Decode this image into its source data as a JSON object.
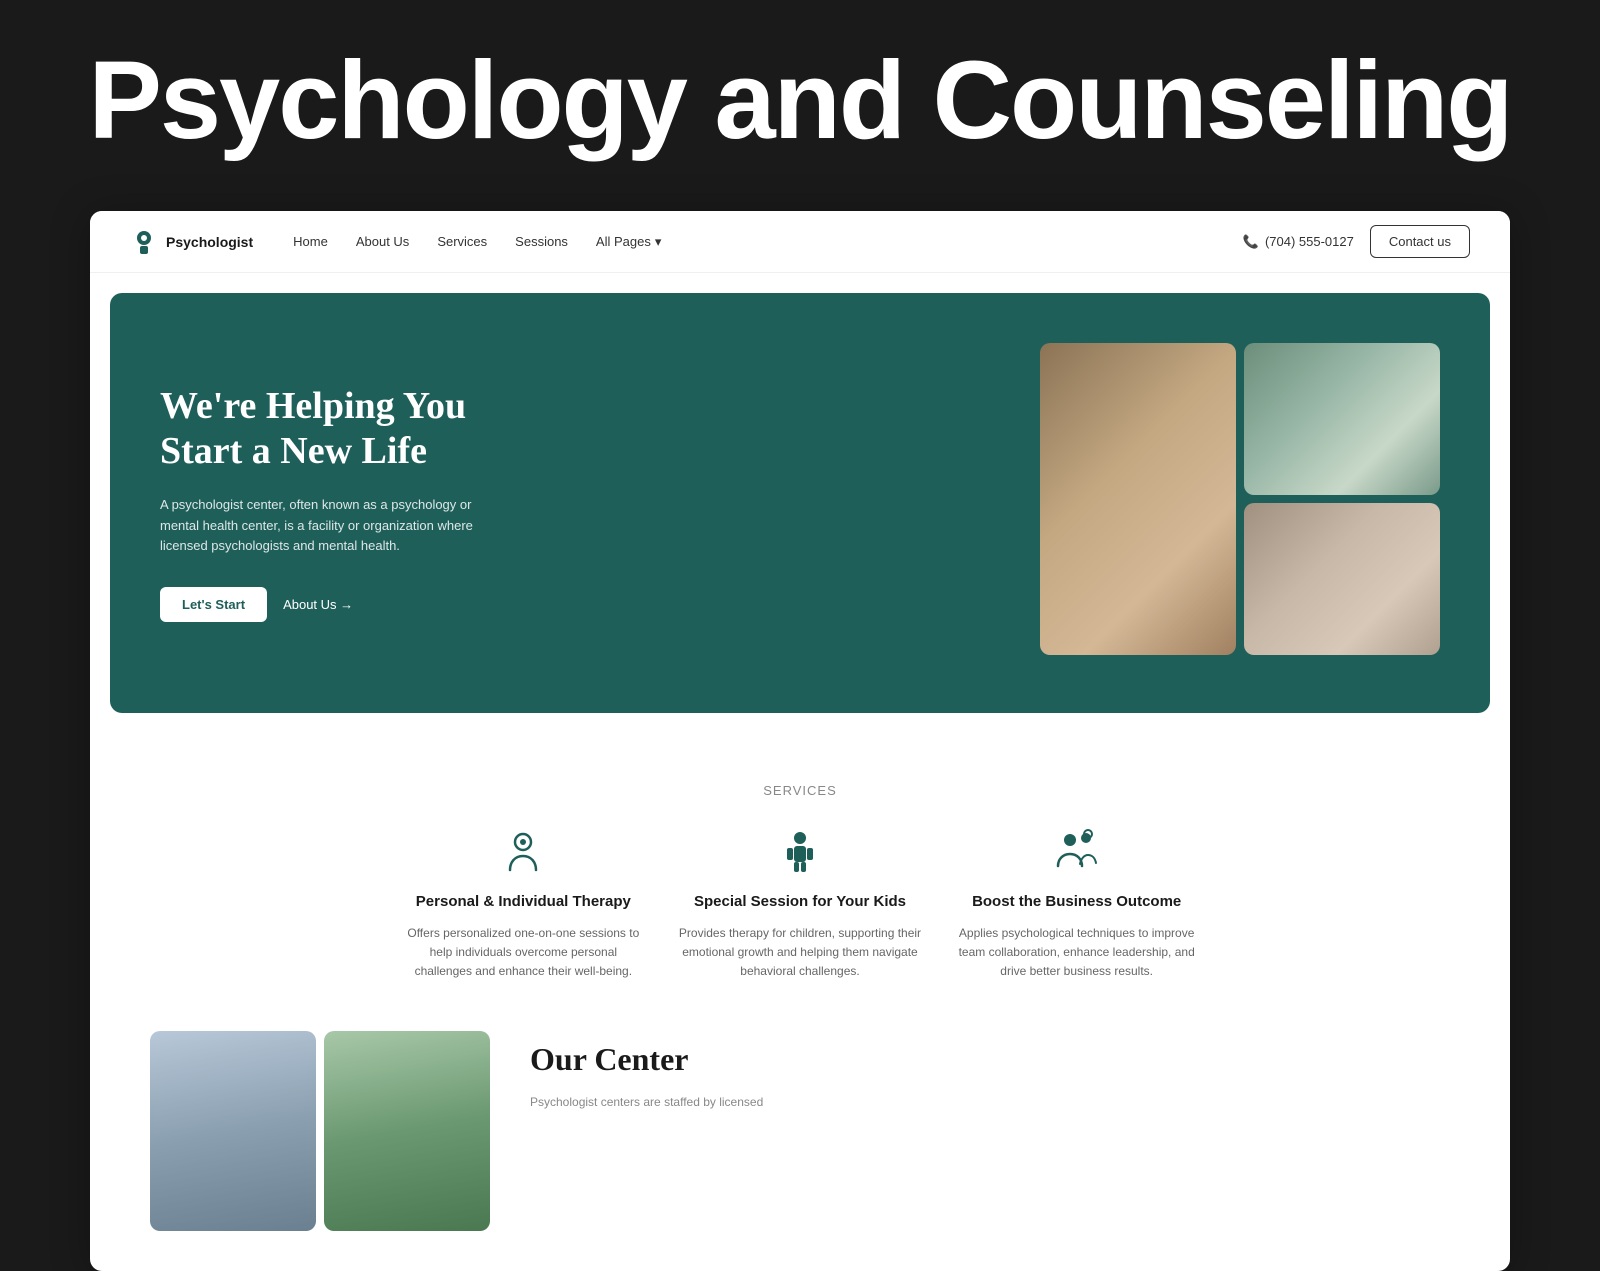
{
  "top_banner": {
    "title": "Psychology and Counseling"
  },
  "nav": {
    "logo_text": "Psychologist",
    "links": [
      {
        "label": "Home",
        "name": "nav-home"
      },
      {
        "label": "About Us",
        "name": "nav-about"
      },
      {
        "label": "Services",
        "name": "nav-services"
      },
      {
        "label": "Sessions",
        "name": "nav-sessions"
      },
      {
        "label": "All Pages",
        "name": "nav-all-pages"
      }
    ],
    "phone": "(704) 555-0127",
    "contact_btn": "Contact us"
  },
  "hero": {
    "heading_line1": "We're Helping You",
    "heading_line2": "Start a New Life",
    "description": "A psychologist center, often known as a psychology or mental health center, is a facility or organization where licensed psychologists and mental health.",
    "btn_start": "Let's Start",
    "btn_about": "About Us →"
  },
  "services": {
    "section_label": "Services",
    "items": [
      {
        "title": "Personal & Individual Therapy",
        "description": "Offers personalized one-on-one sessions to help individuals overcome personal challenges and enhance their well-being."
      },
      {
        "title": "Special Session for Your Kids",
        "description": "Provides therapy for children, supporting their emotional growth and helping them navigate behavioral challenges."
      },
      {
        "title": "Boost the Business Outcome",
        "description": "Applies psychological techniques to improve team collaboration, enhance leadership, and drive better business results."
      }
    ]
  },
  "our_center": {
    "title": "Our Center",
    "description": "Psychologist centers are staffed by licensed"
  }
}
